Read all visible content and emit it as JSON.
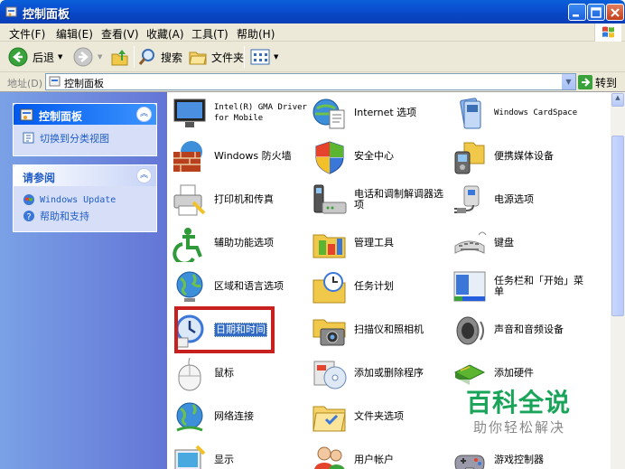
{
  "window": {
    "title": "控制面板"
  },
  "menu": [
    {
      "label": "文件(F)"
    },
    {
      "label": "编辑(E)"
    },
    {
      "label": "查看(V)"
    },
    {
      "label": "收藏(A)"
    },
    {
      "label": "工具(T)"
    },
    {
      "label": "帮助(H)"
    }
  ],
  "toolbar": {
    "back_label": "后退",
    "search_label": "搜索",
    "folders_label": "文件夹"
  },
  "address": {
    "label": "地址(D)",
    "value": "控制面板",
    "go_label": "转到"
  },
  "left_pane": {
    "control_panel": {
      "title": "控制面板",
      "switch_view": "切换到分类视图"
    },
    "see_also": {
      "title": "请参阅",
      "items": [
        {
          "label": "Windows Update"
        },
        {
          "label": "帮助和支持"
        }
      ]
    }
  },
  "items": [
    {
      "label": "Intel(R) GMA Driver for Mobile"
    },
    {
      "label": "Internet 选项"
    },
    {
      "label": "Windows CardSpace"
    },
    {
      "label": "Windows 防火墙"
    },
    {
      "label": "安全中心"
    },
    {
      "label": "便携媒体设备"
    },
    {
      "label": "打印机和传真"
    },
    {
      "label": "电话和调制解调器选项"
    },
    {
      "label": "电源选项"
    },
    {
      "label": "辅助功能选项"
    },
    {
      "label": "管理工具"
    },
    {
      "label": "键盘"
    },
    {
      "label": "区域和语言选项"
    },
    {
      "label": "任务计划"
    },
    {
      "label": "任务栏和「开始」菜单"
    },
    {
      "label": "日期和时间"
    },
    {
      "label": "扫描仪和照相机"
    },
    {
      "label": "声音和音频设备"
    },
    {
      "label": "鼠标"
    },
    {
      "label": "添加或删除程序"
    },
    {
      "label": "添加硬件"
    },
    {
      "label": "网络连接"
    },
    {
      "label": "文件夹选项"
    },
    {
      "label": "显示"
    },
    {
      "label": "用户帐户"
    },
    {
      "label": "游戏控制器"
    }
  ],
  "watermark": {
    "main": "百科全说",
    "sub": "助你轻松解决"
  },
  "colors": {
    "titlebar": "#0a4fd0",
    "highlight": "#316ac5",
    "annotation": "#c8201e",
    "watermark": "#1aa45a"
  }
}
